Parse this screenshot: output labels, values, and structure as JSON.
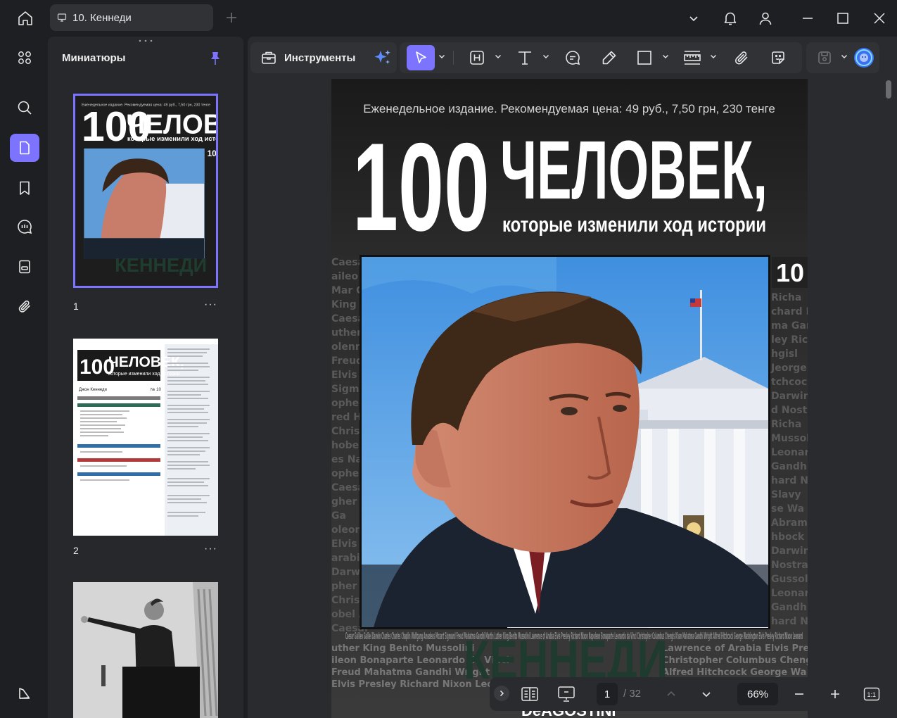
{
  "tab": {
    "title": "10. Кеннеди"
  },
  "sidebar": {
    "title": "Миниатюры"
  },
  "thumbnails": [
    {
      "label": "1",
      "more": "···"
    },
    {
      "label": "2",
      "more": "···"
    }
  ],
  "toolbar": {
    "tools_label": "Инструменты"
  },
  "document": {
    "top_line": "Еженедельное издание. Рекомендуемая цена: 49 руб., 7,50 грн, 230 тенге",
    "big_number": "100",
    "headline": "ЧЕЛОВЕК,",
    "subheadline": "которые изменили ход истории",
    "issue_number": "10",
    "name": "КЕННЕДИ",
    "publisher": "DeAGOSTINI",
    "names_text": "Caesar Galileo Galilei Darwin Charles Charles Chaplin Wolfgang Amadeus Mozart Sigmund Freud Mahatma Gandhi Martin Luther King Benito Mussolini Lawrence of Arabia Elvis Presley Richard Nixon Napoleon Bonaparte Leonardo da Vinci Christopher Columbus Chengis Khan Mahatma Gandhi Wright Alfred Hitchcock George Washington Elvis Presley Richard Nixon Leonard"
  },
  "thumb2": {
    "logo_big": "100",
    "logo_word": "ЧЕЛОВЕК,",
    "logo_sub": "которые изменили ход истории",
    "person": "Джон Кеннеди",
    "issue": "№ 10"
  },
  "nav": {
    "current_page": "1",
    "total_pages": "/ 32",
    "zoom": "66%"
  },
  "colors": {
    "accent": "#7c73ff",
    "app_bg": "#1e1f22",
    "panel_bg": "#27282b"
  }
}
